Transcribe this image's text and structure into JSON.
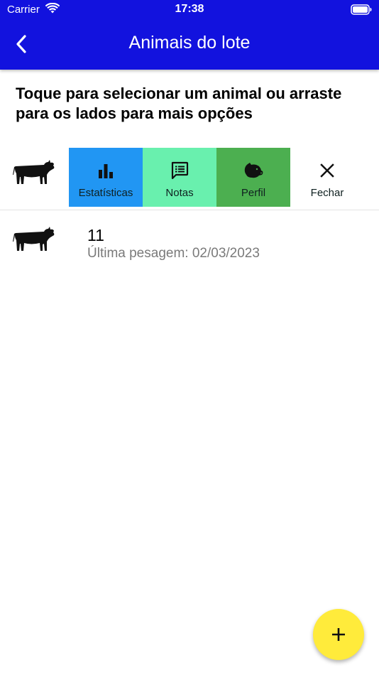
{
  "status_bar": {
    "carrier": "Carrier",
    "time": "17:38"
  },
  "header": {
    "title": "Animais do lote",
    "back_icon": "chevron-left-icon"
  },
  "instruction": "Toque para selecionar um animal ou arraste para os lados para mais opções",
  "swiped_row": {
    "icon": "cow-icon",
    "actions": [
      {
        "label": "Estatísticas",
        "icon": "bar-chart-icon",
        "color": "#2196f3"
      },
      {
        "label": "Notas",
        "icon": "notes-icon",
        "color": "#69f0ae"
      },
      {
        "label": "Perfil",
        "icon": "pig-head-icon",
        "color": "#4caf50"
      },
      {
        "label": "Fechar",
        "icon": "close-icon",
        "color": "#ffffff"
      }
    ]
  },
  "animals": [
    {
      "id": "11",
      "subtitle": "Última pesagem: 02/03/2023",
      "icon": "cow-icon"
    }
  ],
  "fab": {
    "icon": "plus-icon",
    "color": "#ffeb3b"
  },
  "colors": {
    "appbar": "#1212de",
    "subtitle_text": "#7a7a7a"
  }
}
